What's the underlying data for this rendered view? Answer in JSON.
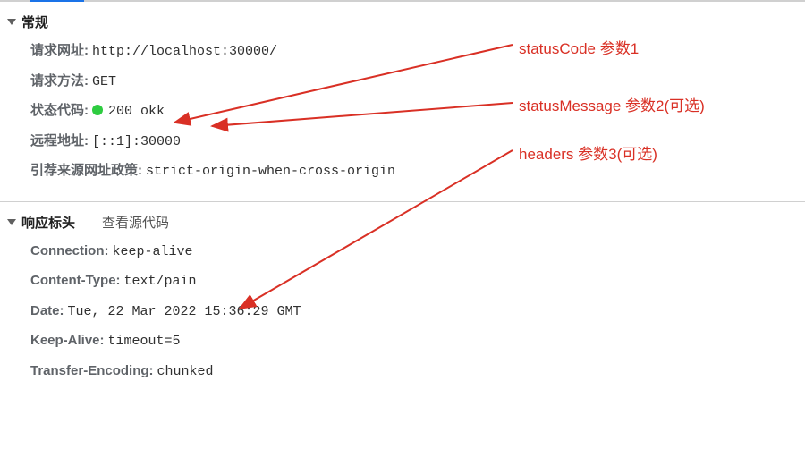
{
  "sections": {
    "general": {
      "title": "常规",
      "request_url_label": "请求网址:",
      "request_url_value": "http://localhost:30000/",
      "request_method_label": "请求方法:",
      "request_method_value": "GET",
      "status_code_label": "状态代码:",
      "status_code_value": "200 okk",
      "remote_address_label": "远程地址:",
      "remote_address_value": "[::1]:30000",
      "referrer_policy_label": "引荐来源网址政策:",
      "referrer_policy_value": "strict-origin-when-cross-origin"
    },
    "response_headers": {
      "title": "响应标头",
      "view_source": "查看源代码",
      "connection_label": "Connection:",
      "connection_value": "keep-alive",
      "content_type_label": "Content-Type:",
      "content_type_value": "text/pain",
      "date_label": "Date:",
      "date_value": "Tue, 22 Mar 2022 15:36:29 GMT",
      "keep_alive_label": "Keep-Alive:",
      "keep_alive_value": "timeout=5",
      "transfer_encoding_label": "Transfer-Encoding:",
      "transfer_encoding_value": "chunked"
    }
  },
  "annotations": {
    "a1": "statusCode  参数1",
    "a2": "statusMessage 参数2(可选)",
    "a3": "headers 参数3(可选)"
  }
}
